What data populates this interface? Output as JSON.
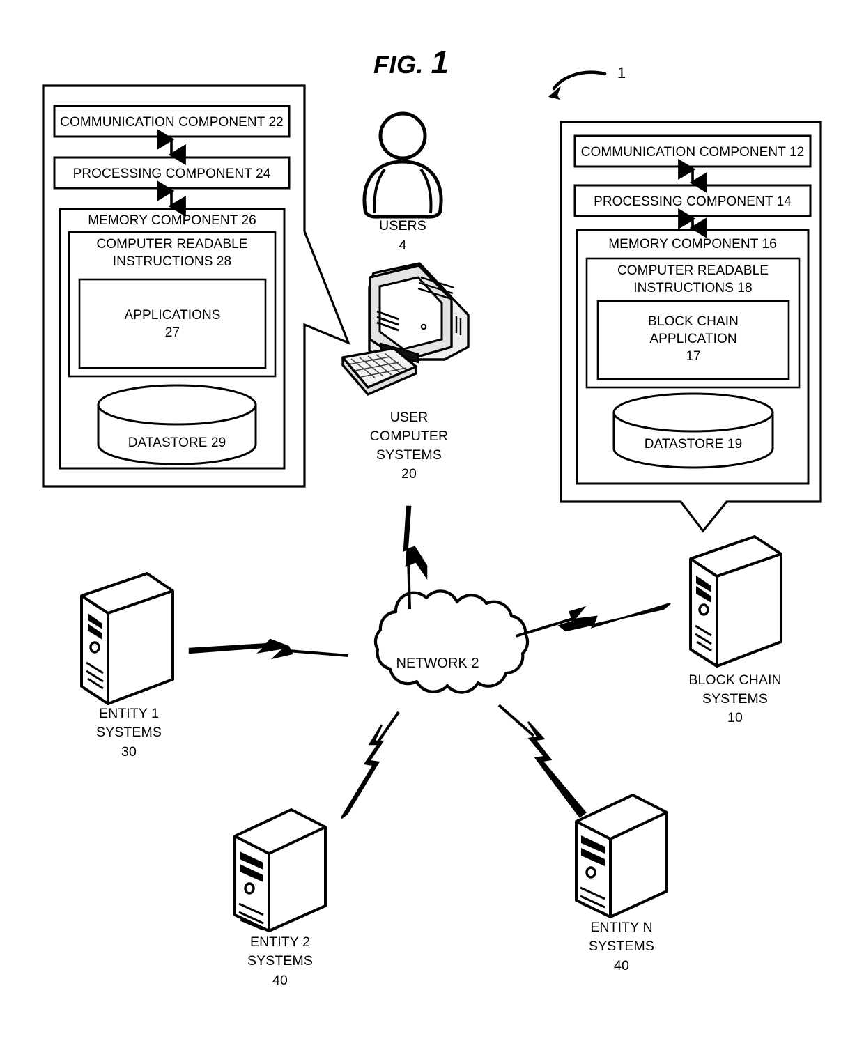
{
  "figure": {
    "title_prefix": "FIG.",
    "title_number": "1",
    "overall_ref": "1"
  },
  "user_computer_box": {
    "communication_component": "COMMUNICATION COMPONENT 22",
    "processing_component": "PROCESSING COMPONENT 24",
    "memory_component": "MEMORY COMPONENT 26",
    "computer_readable_instructions": "COMPUTER READABLE\nINSTRUCTIONS 28",
    "applications": "APPLICATIONS\n27",
    "datastore": "DATASTORE 29"
  },
  "block_chain_box": {
    "communication_component": "COMMUNICATION COMPONENT 12",
    "processing_component": "PROCESSING COMPONENT  14",
    "memory_component": "MEMORY COMPONENT  16",
    "computer_readable_instructions": "COMPUTER READABLE\nINSTRUCTIONS 18",
    "block_chain_application": "BLOCK CHAIN\nAPPLICATION\n17",
    "datastore": "DATASTORE 19"
  },
  "nodes": {
    "users": {
      "label": "USERS",
      "ref": "4"
    },
    "user_computer_systems": {
      "label": "USER\nCOMPUTER\nSYSTEMS",
      "ref": "20"
    },
    "network": {
      "label": "NETWORK 2"
    },
    "block_chain_systems": {
      "label": "BLOCK CHAIN\nSYSTEMS",
      "ref": "10"
    },
    "entity_1_systems": {
      "label": "ENTITY 1\nSYSTEMS",
      "ref": "30"
    },
    "entity_2_systems": {
      "label": "ENTITY 2\nSYSTEMS",
      "ref": "40"
    },
    "entity_n_systems": {
      "label": "ENTITY N\nSYSTEMS",
      "ref": "40"
    }
  },
  "colors": {
    "stroke": "#000000",
    "background": "#ffffff"
  }
}
